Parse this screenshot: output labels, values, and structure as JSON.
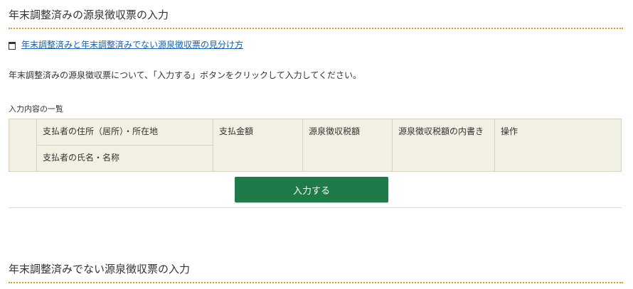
{
  "section1": {
    "title": "年末調整済みの源泉徴収票の入力",
    "help_link": "年末調整済みと年末調整済みでない源泉徴収票の見分け方",
    "instruction": "年末調整済みの源泉徴収票について、「入力する」ボタンをクリックして入力してください。",
    "list_caption": "入力内容の一覧",
    "table": {
      "headers": {
        "payer_address": "支払者の住所（居所）・所在地",
        "payer_name": "支払者の氏名・名称",
        "amount": "支払金額",
        "withholding_tax": "源泉徴収税額",
        "tax_breakdown": "源泉徴収税額の内書き",
        "operation": "操作"
      }
    },
    "input_button": "入力する"
  },
  "section2": {
    "title": "年末調整済みでない源泉徴収票の入力"
  },
  "colors": {
    "button_green": "#1f7a4a",
    "table_header_bg": "#f2efe3",
    "title_dotted_rule": "#c9a227",
    "link_blue": "#1a5fa8"
  }
}
